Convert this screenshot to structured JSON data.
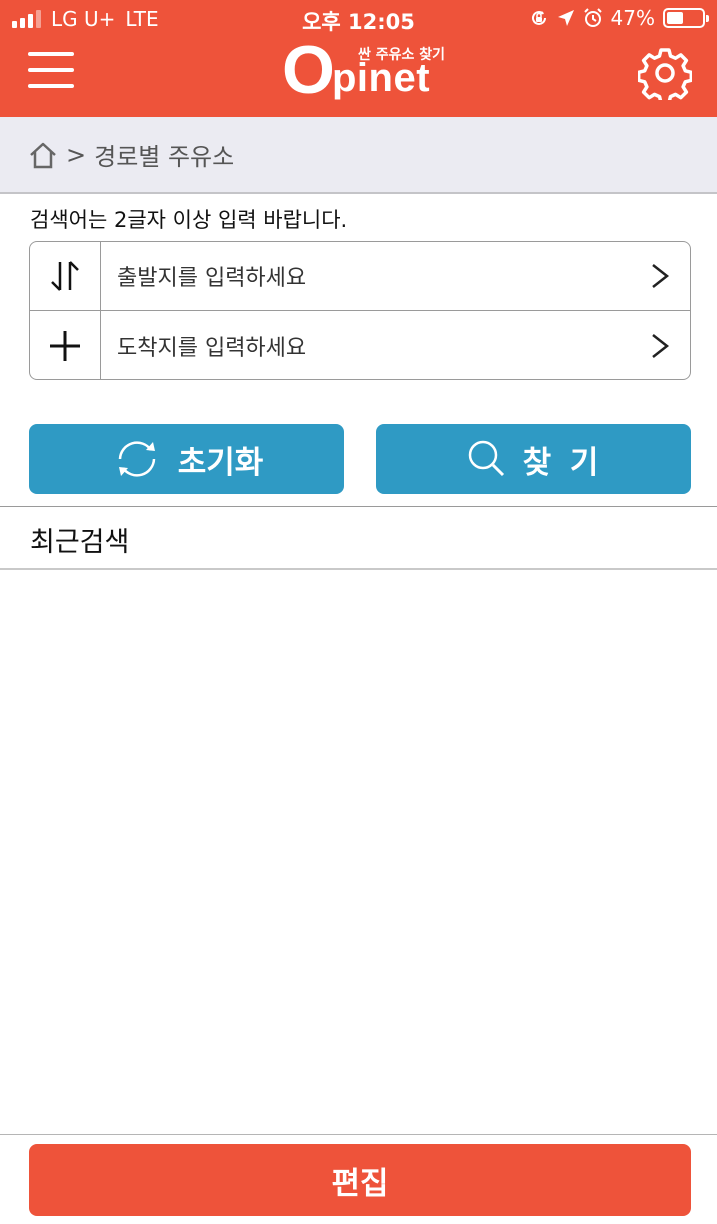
{
  "status_bar": {
    "carrier": "LG U+",
    "network": "LTE",
    "time": "오후 12:05",
    "battery_percent": "47%",
    "battery_level": 0.47,
    "signal_bars_active": 3,
    "signal_bars_total": 4
  },
  "header": {
    "logo_word": "pinet",
    "logo_letter": "O",
    "logo_tagline": "싼 주유소 찾기",
    "menu_icon": "hamburger-menu-icon",
    "settings_icon": "gear-icon"
  },
  "breadcrumb": {
    "home_icon": "home-icon",
    "separator": ">",
    "current": "경로별 주유소"
  },
  "search": {
    "hint": "검색어는 2글자 이상 입력 바랍니다.",
    "origin_placeholder": "출발지를 입력하세요",
    "destination_placeholder": "도착지를 입력하세요",
    "swap_icon": "swap-arrows-icon",
    "add_icon": "plus-icon"
  },
  "buttons": {
    "reset_label": "초기화",
    "find_label": "찾 기",
    "edit_label": "편집"
  },
  "recent": {
    "title": "최근검색",
    "items": []
  },
  "colors": {
    "brand_orange": "#ee533a",
    "button_blue": "#2f9ac4",
    "breadcrumb_bg": "#ebebf2"
  }
}
